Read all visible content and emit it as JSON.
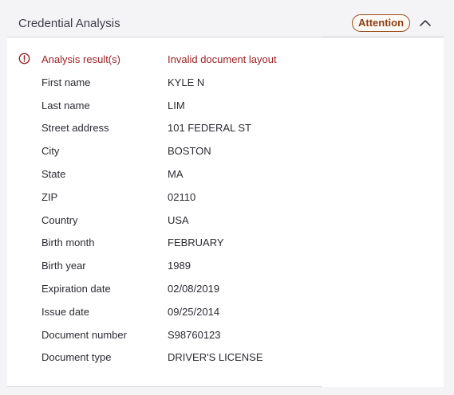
{
  "header": {
    "title": "Credential Analysis",
    "badge": "Attention",
    "collapse_icon": "chevron-up-icon"
  },
  "alert": {
    "icon": "alert-circle-icon",
    "label": "Analysis result(s)",
    "value": "Invalid document layout",
    "color": "#9b2226"
  },
  "fields": [
    {
      "label": "First name",
      "value": "KYLE N"
    },
    {
      "label": "Last name",
      "value": "LIM"
    },
    {
      "label": "Street address",
      "value": "101 FEDERAL ST"
    },
    {
      "label": "City",
      "value": "BOSTON"
    },
    {
      "label": "State",
      "value": "MA"
    },
    {
      "label": "ZIP",
      "value": "02110"
    },
    {
      "label": "Country",
      "value": "USA"
    },
    {
      "label": "Birth month",
      "value": "FEBRUARY"
    },
    {
      "label": "Birth year",
      "value": "1989"
    },
    {
      "label": "Expiration date",
      "value": "02/08/2019"
    },
    {
      "label": "Issue date",
      "value": "09/25/2014"
    },
    {
      "label": "Document number",
      "value": "S98760123"
    },
    {
      "label": "Document type",
      "value": "DRIVER'S LICENSE"
    }
  ]
}
